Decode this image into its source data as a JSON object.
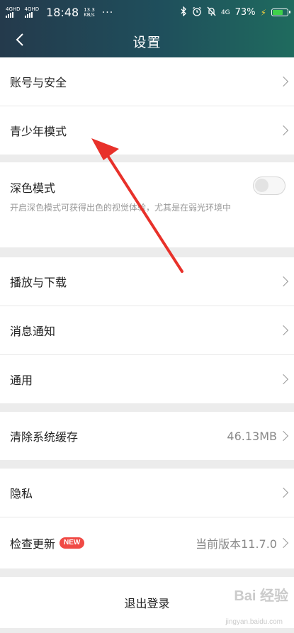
{
  "status_bar": {
    "sim1": "4GHD",
    "sim2": "4GHD",
    "time": "18:48",
    "speed_value": "13.3",
    "speed_unit": "KB/s",
    "more": "···",
    "network": "4G",
    "battery": "73%",
    "battery_level_percent": 73,
    "battery_color": "#3fd14a"
  },
  "header": {
    "title": "设置",
    "back_icon": "chevron-left-icon",
    "background": "#1f4f5c"
  },
  "rows": {
    "account": {
      "label": "账号与安全"
    },
    "youth": {
      "label": "青少年模式"
    },
    "dark": {
      "label": "深色模式",
      "desc": "开启深色模式可获得出色的视觉体验，尤其是在弱光环境中",
      "enabled": false
    },
    "playback": {
      "label": "播放与下载"
    },
    "notify": {
      "label": "消息通知"
    },
    "general": {
      "label": "通用"
    },
    "cache": {
      "label": "清除系统缓存",
      "value": "46.13MB"
    },
    "privacy": {
      "label": "隐私"
    },
    "update": {
      "label": "检查更新",
      "badge": "NEW",
      "value": "当前版本11.7.0"
    },
    "logout": {
      "label": "退出登录"
    }
  },
  "annotation": {
    "color": "#e8312a",
    "points_to": "青少年模式"
  },
  "watermark": {
    "text": "Bai 经验",
    "sub": "jingyan.baidu.com"
  }
}
